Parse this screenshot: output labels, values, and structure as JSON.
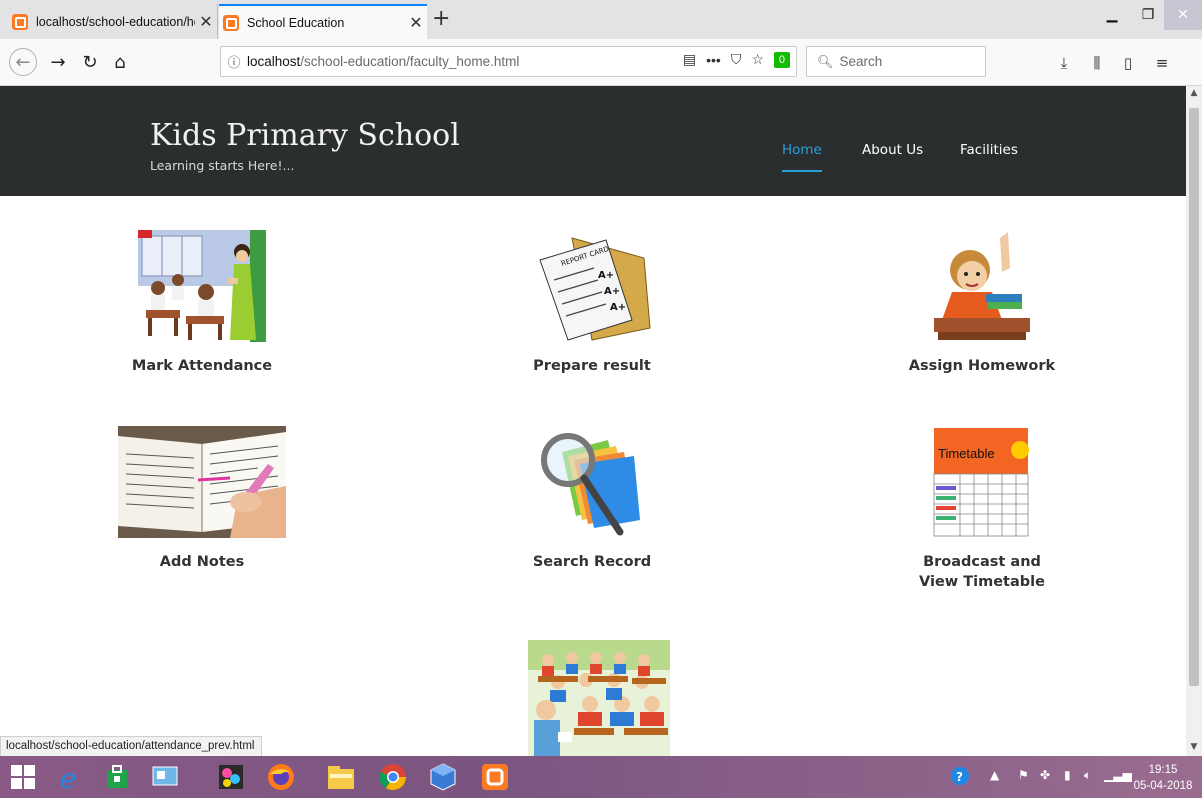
{
  "browser": {
    "tabs": [
      {
        "title": "localhost/school-education/ho",
        "active": false
      },
      {
        "title": "School Education",
        "active": true
      }
    ],
    "new_tab_symbol": "+",
    "url_host": "localhost",
    "url_path": "/school-education/faculty_home.html",
    "search_placeholder": "Search",
    "shield_count": "0",
    "status_link": "localhost/school-education/attendance_prev.html"
  },
  "site": {
    "brand": "Kids Primary School",
    "tagline": "Learning starts Here!...",
    "nav": [
      {
        "label": "Home",
        "active": true
      },
      {
        "label": "About Us",
        "active": false
      },
      {
        "label": "Facilities",
        "active": false
      }
    ]
  },
  "features": [
    {
      "label": "Mark Attendance",
      "icon": "classroom-teacher-image"
    },
    {
      "label": "Prepare result",
      "icon": "report-card-image"
    },
    {
      "label": "Assign Homework",
      "icon": "student-raising-hand-image"
    },
    {
      "label": "Add Notes",
      "icon": "writing-notes-image"
    },
    {
      "label": "Search Record",
      "icon": "search-folders-image"
    },
    {
      "label": "Broadcast and View Timetable",
      "label_line1": "Broadcast and",
      "label_line2": "View Timetable",
      "icon": "timetable-image"
    },
    {
      "label": "",
      "icon": "classroom-students-image"
    }
  ],
  "timetable_image_text": "Timetable",
  "taskbar": {
    "time": "19:15",
    "date": "05-04-2018"
  },
  "colors": {
    "header_bg": "#2b2e2f",
    "nav_active": "#2a9fd6",
    "tab_accent": "#0a84ff",
    "taskbar": "#8a5a86"
  }
}
